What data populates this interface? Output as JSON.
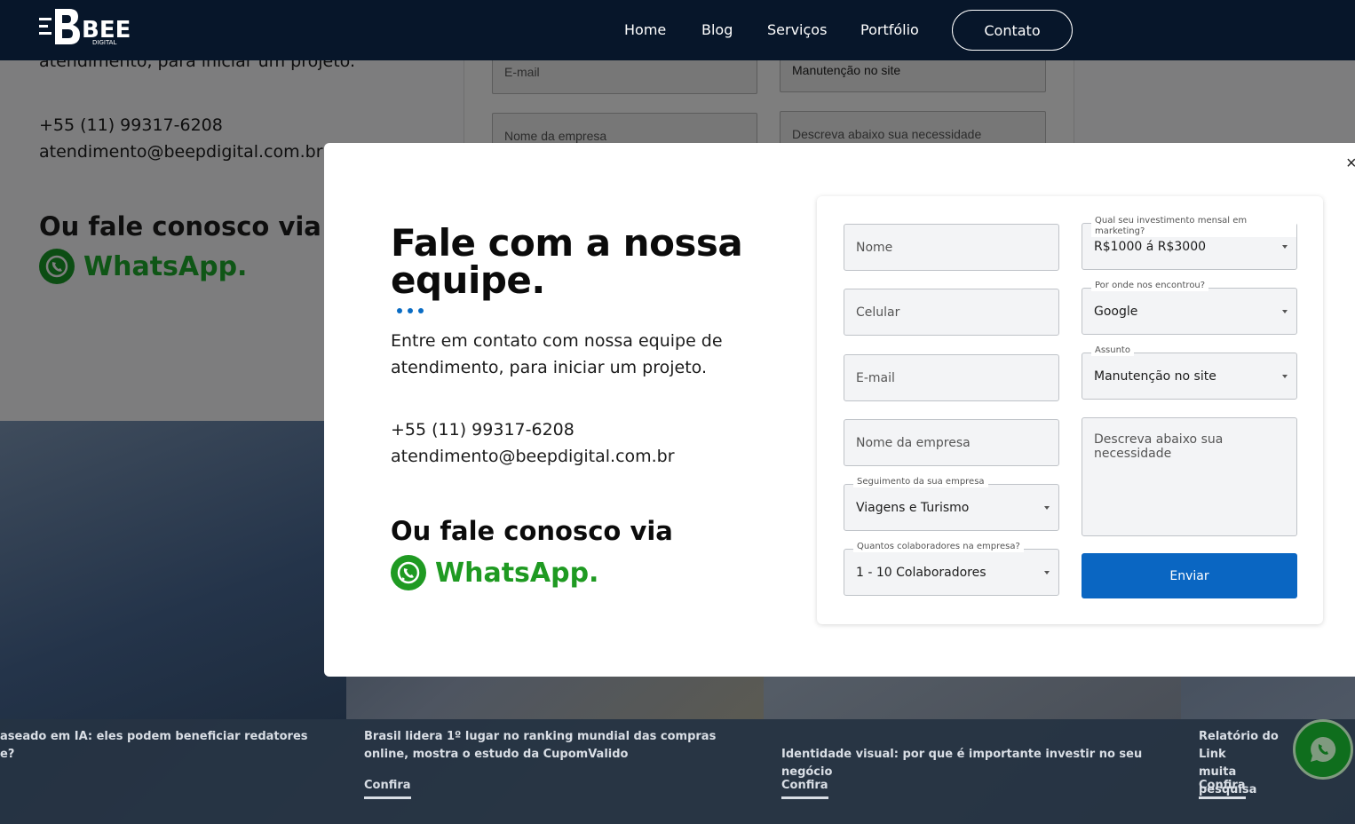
{
  "header": {
    "logo_text": "BEEP",
    "logo_sub": "DIGITAL",
    "nav": [
      "Home",
      "Blog",
      "Serviços",
      "Portfólio"
    ],
    "contact_label": "Contato"
  },
  "background": {
    "desc_tail": "atendimento, para iniciar um projeto.",
    "phone": "+55 (11) 99317-6208",
    "email": "atendimento@beepdigital.com.br",
    "via_label": "Ou fale conosco via",
    "whatsapp_label": "WhatsApp.",
    "form_fields": [
      "E-mail",
      "Manutenção no site",
      "Nome da empresa",
      "Descreva abaixo sua necessidade"
    ]
  },
  "blog": {
    "cards": [
      {
        "title": "aseado em IA: eles podem beneficiar redatores\ne?",
        "link": ""
      },
      {
        "title": "Brasil lidera 1º lugar no ranking mundial das compras online, mostra o estudo da CupomValido",
        "link": "Confira"
      },
      {
        "title": "Identidade visual: por que é importante investir no seu negócio",
        "link": "Confira"
      },
      {
        "title": "Relatório do Link\nmuita pesquisa",
        "link": "Confira"
      }
    ]
  },
  "modal": {
    "close_glyph": "×",
    "title": "Fale com a nossa equipe.",
    "description": "Entre em contato com nossa equipe de atendimento, para iniciar um projeto.",
    "phone": "+55 (11) 99317-6208",
    "email": "atendimento@beepdigital.com.br",
    "via_label": "Ou fale conosco via",
    "whatsapp_label": "WhatsApp.",
    "form": {
      "name_placeholder": "Nome",
      "phone_placeholder": "Celular",
      "email_placeholder": "E-mail",
      "company_placeholder": "Nome da empresa",
      "segment_label": "Seguimento da sua empresa",
      "segment_value": "Viagens e Turismo",
      "employees_label": "Quantos colaboradores na empresa?",
      "employees_value": "1 - 10 Colaboradores",
      "investment_label": "Qual seu investimento mensal em marketing?",
      "investment_value": "R$1000 á R$3000",
      "source_label": "Por onde nos encontrou?",
      "source_value": "Google",
      "subject_label": "Assunto",
      "subject_value": "Manutenção no site",
      "message_placeholder": "Descreva abaixo sua necessidade",
      "submit_label": "Enviar"
    }
  },
  "colors": {
    "header_bg": "#07162a",
    "accent_blue": "#0a66c2",
    "whatsapp_green": "#1f9a22"
  }
}
